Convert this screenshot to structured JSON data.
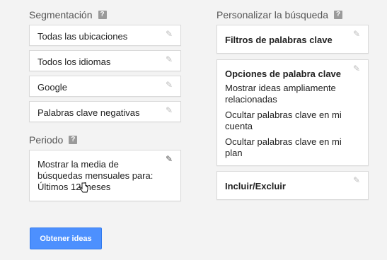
{
  "segmentation": {
    "title": "Segmentación",
    "items": [
      {
        "label": "Todas las ubicaciones"
      },
      {
        "label": "Todos los idiomas"
      },
      {
        "label": "Google"
      },
      {
        "label": "Palabras clave negativas"
      }
    ]
  },
  "period": {
    "title": "Periodo",
    "text": "Mostrar la media de búsquedas mensuales para: Últimos 12 meses"
  },
  "customize": {
    "title": "Personalizar la búsqueda",
    "keyword_filters": "Filtros de palabras clave",
    "keyword_options": {
      "title": "Opciones de palabra clave",
      "items": [
        "Mostrar ideas ampliamente relacionadas",
        "Ocultar palabras clave en mi cuenta",
        "Ocultar palabras clave en mi plan"
      ]
    },
    "include_exclude": "Incluir/Excluir"
  },
  "actions": {
    "get_ideas": "Obtener ideas"
  },
  "icons": {
    "help": "help-icon",
    "edit": "pencil-icon"
  },
  "colors": {
    "accent": "#4d90fe",
    "background": "#f3f3f3"
  }
}
